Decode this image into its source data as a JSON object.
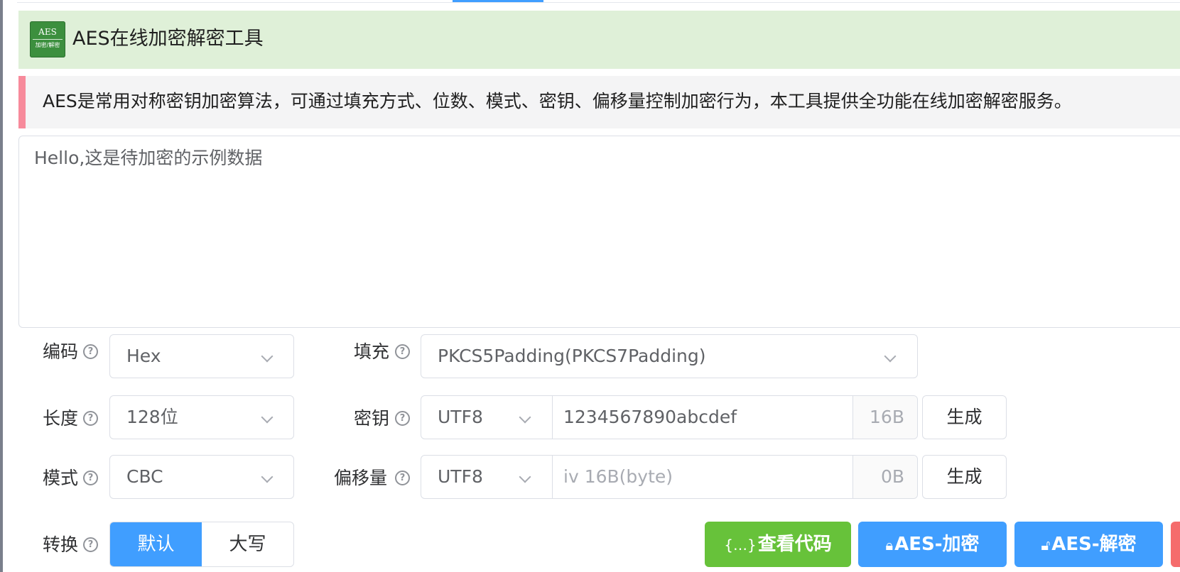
{
  "colors": {
    "primary": "#409eff",
    "success": "#67c23a",
    "danger": "#f56c6c",
    "header_bg": "#dff0d8",
    "desc_accent": "#f78a9b"
  },
  "header": {
    "logo_top": "AES",
    "logo_bottom": "加密/解密",
    "title": "AES在线加密解密工具"
  },
  "description": "AES是常用对称密钥加密算法，可通过填充方式、位数、模式、密钥、偏移量控制加密行为，本工具提供全功能在线加密解密服务。",
  "input": {
    "placeholder": "Hello,这是待加密的示例数据"
  },
  "form": {
    "encoding": {
      "label": "编码",
      "value": "Hex"
    },
    "padding": {
      "label": "填充",
      "value": "PKCS5Padding(PKCS7Padding)"
    },
    "length": {
      "label": "长度",
      "value": "128位"
    },
    "key": {
      "label": "密钥",
      "encoding": "UTF8",
      "value": "1234567890abcdef",
      "size": "16B",
      "generate": "生成"
    },
    "mode": {
      "label": "模式",
      "value": "CBC"
    },
    "iv": {
      "label": "偏移量",
      "encoding": "UTF8",
      "placeholder": "iv 16B(byte)",
      "size": "0B",
      "generate": "生成"
    },
    "convert": {
      "label": "转换",
      "options": [
        "默认",
        "大写"
      ],
      "selected": "默认"
    }
  },
  "actions": {
    "view_code": "查看代码",
    "encrypt": "AES-加密",
    "decrypt": "AES-解密"
  },
  "icons": {
    "help": "question-circle-icon",
    "chevron": "chevron-down-icon",
    "code": "code-braces-icon",
    "lock": "lock-icon",
    "unlock": "unlock-icon"
  }
}
